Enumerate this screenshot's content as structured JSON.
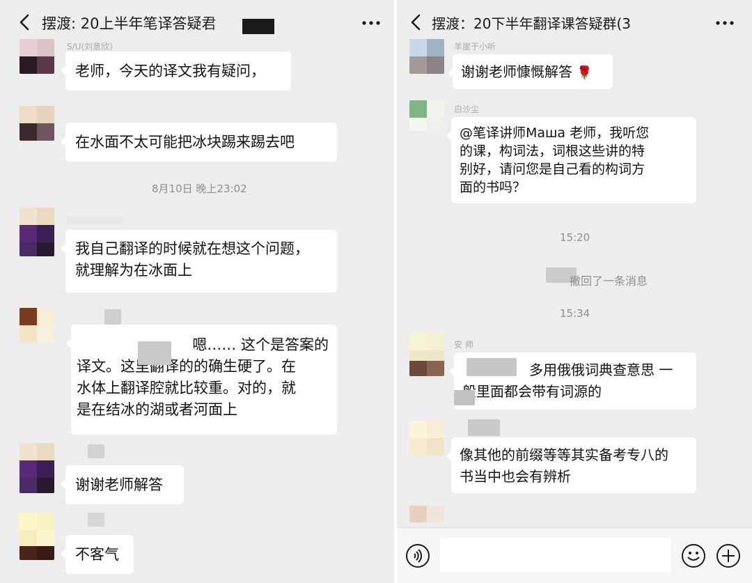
{
  "left": {
    "title": "摆渡: 20上半年笔译答疑君",
    "messages": [
      "老师，今天的译文我有疑问，",
      "在水面不太可能把冰块踢来踢去吧",
      [
        "我自己翻译的时候就在想这个问题，",
        "就理解为在冰面上"
      ],
      [
        "嗯…… 这个是答案的",
        "译文。这里翻译的的确生硬了。在",
        "水体上翻译腔就比较重。对的，就",
        "是在结冰的湖或者河面上"
      ],
      "谢谢老师解答",
      "不客气"
    ],
    "timestamp": "8月10日 晚上23:02",
    "nick_top": "S/U(刘意欣)"
  },
  "right": {
    "title": "摆渡：20下半年翻译课答疑群(3",
    "nick_top": "羊崖于小听",
    "messages": [
      "谢谢老师慷慨解答",
      [
        "@笔译讲师Маша 老师，我听您",
        "的课，构词法，词根这些讲的特",
        "别好，请问您是自己看的构词方",
        "面的书吗？"
      ],
      [
        "多用俄俄词典查意思 一",
        "般里面都会带有词源的"
      ],
      [
        "像其他的前缀等等其实备考专八的",
        "书当中也会有辨析"
      ]
    ],
    "nick_2": "白沙尘",
    "timestamp_1": "15:20",
    "recall_notice": "撤回了一条消息",
    "timestamp_2": "15:34",
    "nick_3": "安 师",
    "rose_emoji": "🌹"
  },
  "icons": [
    "back-arrow-icon",
    "more-icon",
    "voice-icon",
    "emoji-icon",
    "plus-icon",
    "rose-icon"
  ]
}
